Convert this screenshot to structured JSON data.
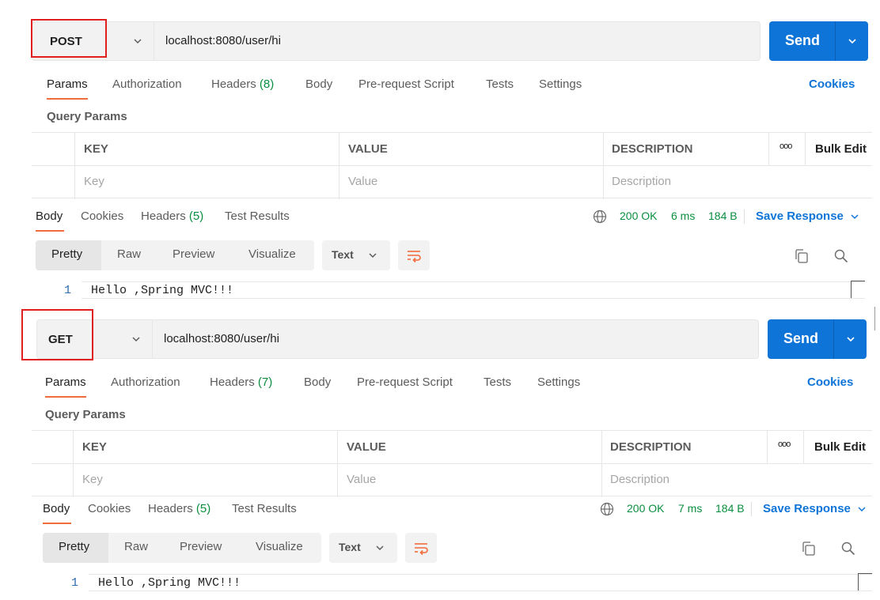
{
  "requests": [
    {
      "method": "POST",
      "url": "localhost:8080/user/hi",
      "send_label": "Send",
      "tabs": {
        "params": "Params",
        "authorization": "Authorization",
        "headers": "Headers",
        "headers_count": "(8)",
        "body": "Body",
        "prerequest": "Pre-request Script",
        "tests": "Tests",
        "settings": "Settings"
      },
      "cookies_link": "Cookies",
      "query_params_title": "Query Params",
      "table": {
        "col_key": "KEY",
        "col_value": "VALUE",
        "col_description": "DESCRIPTION",
        "bulk_edit": "Bulk Edit",
        "more": "ooo",
        "key_placeholder": "Key",
        "value_placeholder": "Value",
        "description_placeholder": "Description"
      },
      "response": {
        "tabs": {
          "body": "Body",
          "cookies": "Cookies",
          "headers": "Headers",
          "headers_count": "(5)",
          "test_results": "Test Results"
        },
        "status": "200 OK",
        "time": "6 ms",
        "size": "184 B",
        "save_response": "Save Response",
        "views": {
          "pretty": "Pretty",
          "raw": "Raw",
          "preview": "Preview",
          "visualize": "Visualize"
        },
        "format": "Text",
        "line_number": "1",
        "body_text": "Hello ,Spring MVC!!!"
      }
    },
    {
      "method": "GET",
      "url": "localhost:8080/user/hi",
      "send_label": "Send",
      "tabs": {
        "params": "Params",
        "authorization": "Authorization",
        "headers": "Headers",
        "headers_count": "(7)",
        "body": "Body",
        "prerequest": "Pre-request Script",
        "tests": "Tests",
        "settings": "Settings"
      },
      "cookies_link": "Cookies",
      "query_params_title": "Query Params",
      "table": {
        "col_key": "KEY",
        "col_value": "VALUE",
        "col_description": "DESCRIPTION",
        "bulk_edit": "Bulk Edit",
        "more": "ooo",
        "key_placeholder": "Key",
        "value_placeholder": "Value",
        "description_placeholder": "Description"
      },
      "response": {
        "tabs": {
          "body": "Body",
          "cookies": "Cookies",
          "headers": "Headers",
          "headers_count": "(5)",
          "test_results": "Test Results"
        },
        "status": "200 OK",
        "time": "7 ms",
        "size": "184 B",
        "save_response": "Save Response",
        "views": {
          "pretty": "Pretty",
          "raw": "Raw",
          "preview": "Preview",
          "visualize": "Visualize"
        },
        "format": "Text",
        "line_number": "1",
        "body_text": "Hello ,Spring MVC!!!"
      }
    }
  ],
  "colors": {
    "accent": "#0f74d8",
    "active_tab_underline": "#f26b3a",
    "status_green": "#0a8e3f",
    "highlight_box": "#e0201e"
  }
}
